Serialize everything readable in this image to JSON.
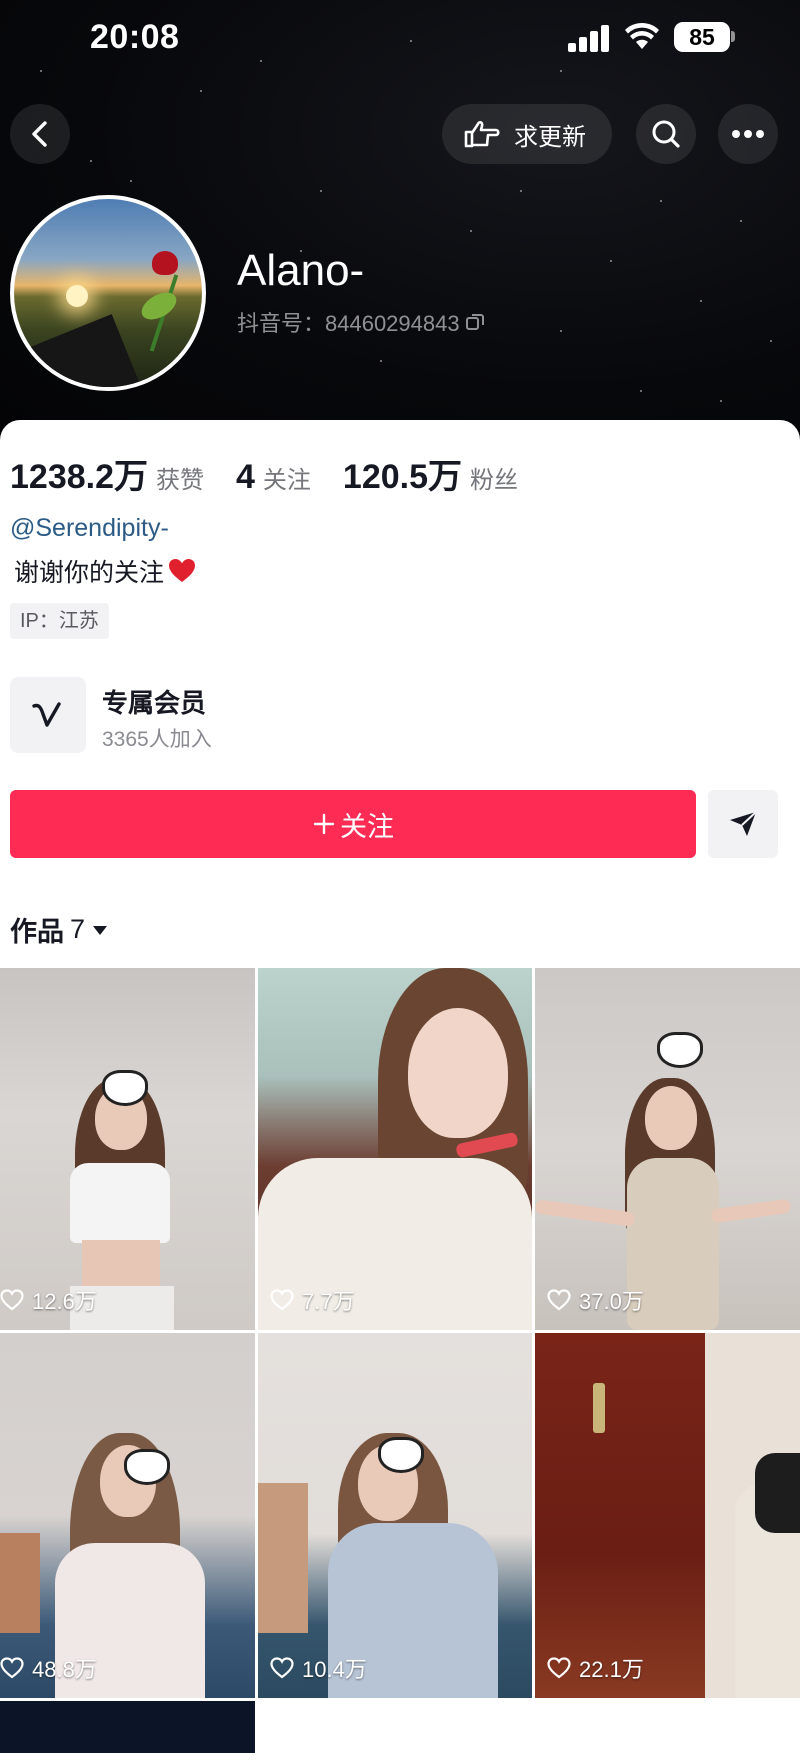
{
  "status_bar": {
    "time": "20:08",
    "battery": "85"
  },
  "nav": {
    "update_label": "求更新"
  },
  "profile": {
    "nickname": "Alano-",
    "douyin_id": "抖音号：84460294843",
    "stats": [
      {
        "value": "1238.2万",
        "label": "获赞"
      },
      {
        "value": "4",
        "label": "关注"
      },
      {
        "value": "120.5万",
        "label": "粉丝"
      }
    ],
    "mention": "@Serendipity-",
    "bio": "谢谢你的关注",
    "ip": "IP：江苏"
  },
  "membership": {
    "title": "专属会员",
    "count": "3365人加入"
  },
  "actions": {
    "follow_label": "关注"
  },
  "works": {
    "tab_label": "作品",
    "count": "7",
    "items": [
      {
        "likes": "12.6万"
      },
      {
        "likes": "7.7万"
      },
      {
        "likes": "37.0万"
      },
      {
        "likes": "48.8万"
      },
      {
        "likes": "10.4万"
      },
      {
        "likes": "22.1万"
      }
    ]
  },
  "colors": {
    "accent": "#fe2c55",
    "mention": "#2c5b86",
    "header_bg": "#07080b"
  }
}
